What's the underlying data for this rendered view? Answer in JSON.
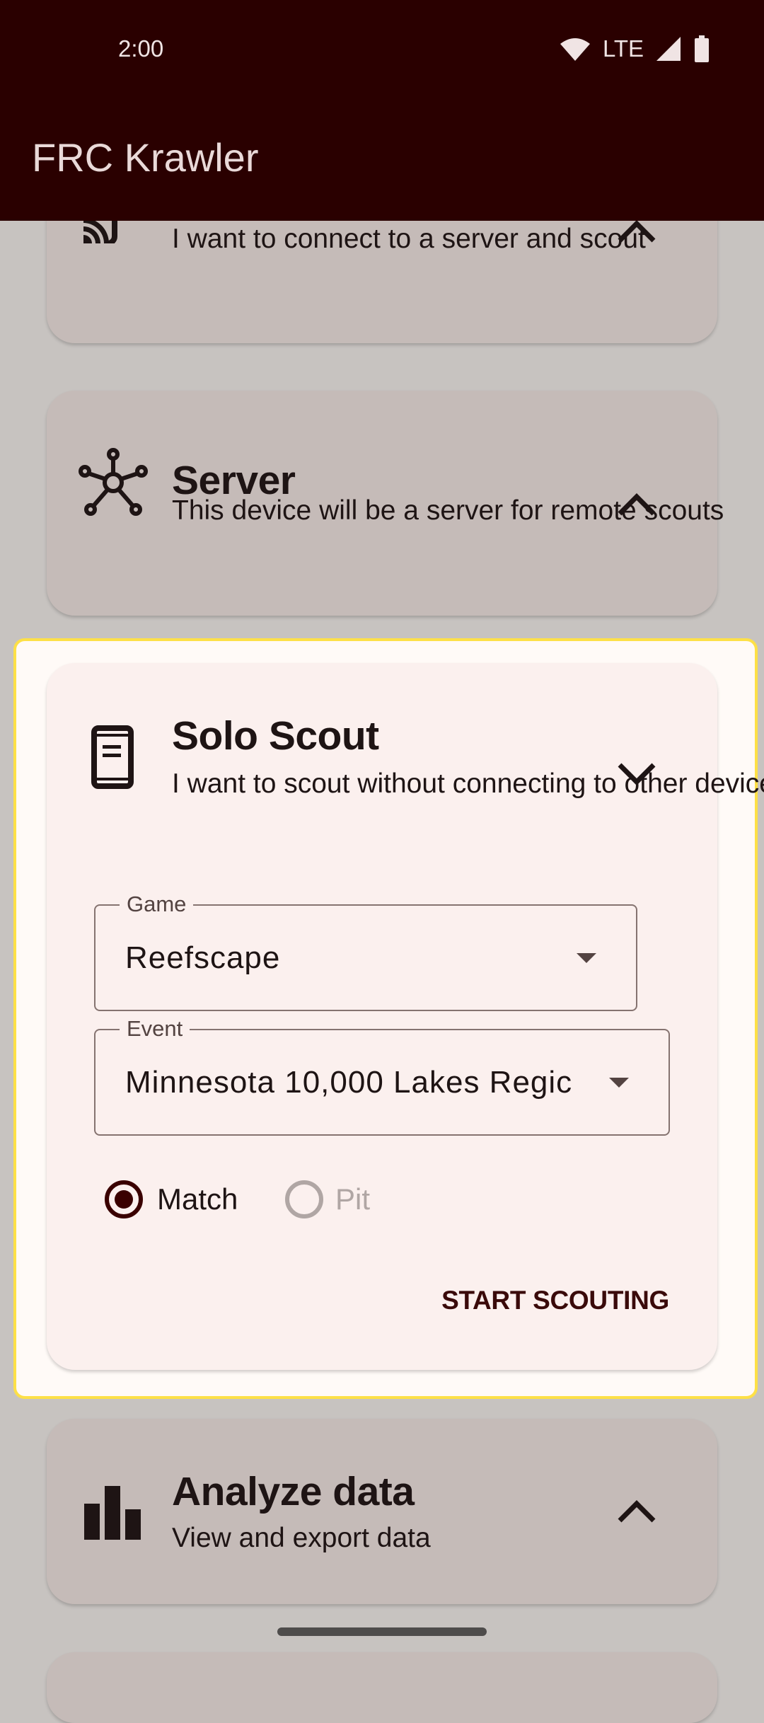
{
  "status_bar": {
    "time": "2:00",
    "network": "LTE",
    "icons": [
      "wifi-icon",
      "signal-icon",
      "battery-icon"
    ]
  },
  "app_bar": {
    "title": "FRC Krawler"
  },
  "colors": {
    "primary": "#2a0000",
    "highlight": "#fde047",
    "card_active": "#fbf0ee",
    "card_inactive": "#c5bbb8"
  },
  "cards": {
    "remote": {
      "subtitle": "I want to connect to a server and scout",
      "icon": "cast-icon",
      "expanded": false
    },
    "server": {
      "title": "Server",
      "subtitle": "This device will be a server for remote scouts",
      "icon": "hub-icon",
      "expanded": false
    },
    "solo": {
      "title": "Solo Scout",
      "subtitle": "I want to scout without connecting to other devices",
      "icon": "phone-icon",
      "expanded": true,
      "game": {
        "label": "Game",
        "value": "Reefscape"
      },
      "event": {
        "label": "Event",
        "value": "Minnesota 10,000 Lakes Regic"
      },
      "mode": {
        "options": [
          "Match",
          "Pit"
        ],
        "selected": "Match",
        "disabled": [
          "Pit"
        ]
      },
      "start_label": "START SCOUTING"
    },
    "analyze": {
      "title": "Analyze data",
      "subtitle": "View and export data",
      "icon": "bar-chart-icon",
      "expanded": false
    }
  }
}
